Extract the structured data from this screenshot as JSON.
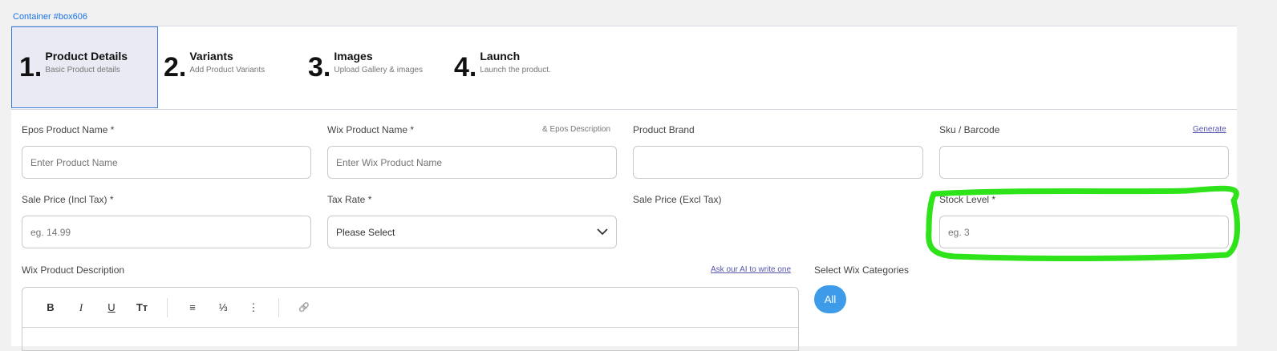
{
  "container_label": "Container #box606",
  "steps": [
    {
      "num": "1.",
      "title": "Product Details",
      "subtitle": "Basic Product details"
    },
    {
      "num": "2.",
      "title": "Variants",
      "subtitle": "Add Product Variants"
    },
    {
      "num": "3.",
      "title": "Images",
      "subtitle": "Upload Gallery & images"
    },
    {
      "num": "4.",
      "title": "Launch",
      "subtitle": "Launch the product."
    }
  ],
  "fields": {
    "epos_name": {
      "label": "Epos Product Name *",
      "placeholder": "Enter Product Name"
    },
    "wix_name": {
      "label": "Wix Product Name *",
      "hint": "& Epos Description",
      "placeholder": "Enter Wix Product Name"
    },
    "brand": {
      "label": "Product Brand",
      "placeholder": ""
    },
    "sku": {
      "label": "Sku / Barcode",
      "link": "Generate",
      "placeholder": ""
    },
    "sale_incl": {
      "label": "Sale Price (Incl Tax) *",
      "placeholder": "eg. 14.99"
    },
    "tax_rate": {
      "label": "Tax Rate *",
      "value": "Please Select"
    },
    "sale_excl": {
      "label": "Sale Price (Excl Tax)"
    },
    "stock": {
      "label": "Stock Level *",
      "placeholder": "eg. 3"
    },
    "description": {
      "label": "Wix Product Description",
      "link": "Ask our AI to write one"
    },
    "categories": {
      "label": "Select Wix Categories",
      "pill": "All"
    }
  },
  "toolbar": {
    "bold": "B",
    "italic": "I",
    "underline": "U",
    "text_size": "Tт",
    "align": "≡",
    "ordered": "⅓",
    "bullets": "⋮",
    "link": "🔗"
  },
  "annotation_color": "#2ee31a"
}
